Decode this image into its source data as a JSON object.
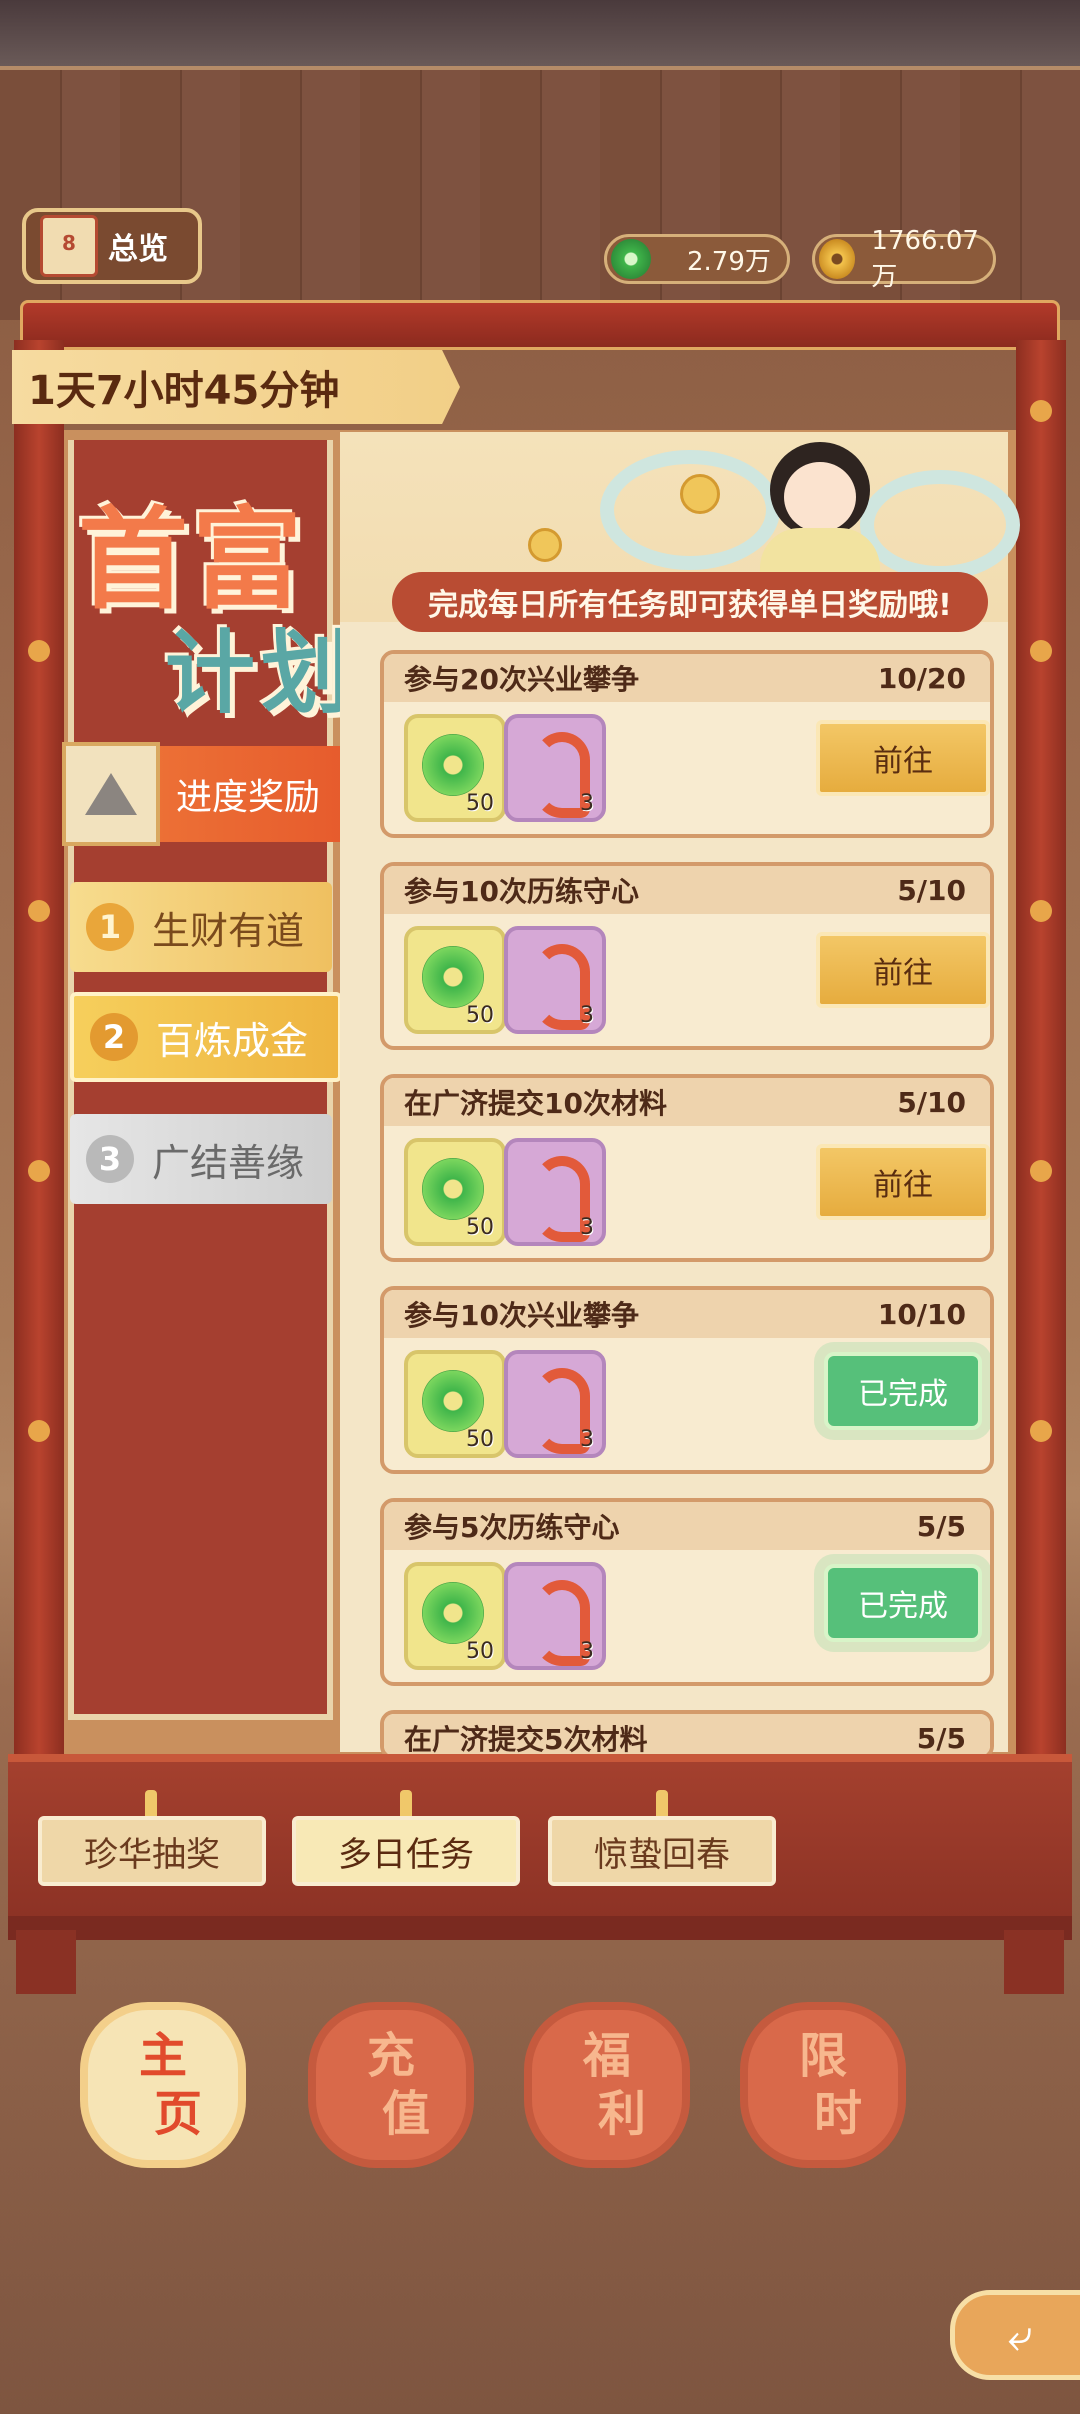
{
  "header": {
    "overview_label": "总览",
    "overview_icon_text": "8",
    "jade_amount": "2.79万",
    "gold_amount": "1766.07万"
  },
  "timer": "1天7小时45分钟",
  "event": {
    "title_line1": "首富",
    "title_line2": "计划",
    "progress_tab": "进度奖励",
    "tabs": [
      {
        "num": "1",
        "label": "生财有道",
        "state": "normal"
      },
      {
        "num": "2",
        "label": "百炼成金",
        "state": "selected"
      },
      {
        "num": "3",
        "label": "广结善缘",
        "state": "locked"
      }
    ],
    "notice": "完成每日所有任务即可获得单日奖励哦!"
  },
  "tasks": [
    {
      "name": "参与20次兴业攀争",
      "progress": "10/20",
      "jade_count": "50",
      "snake_count": "3",
      "action": "前往",
      "done": false
    },
    {
      "name": "参与10次历练守心",
      "progress": "5/10",
      "jade_count": "50",
      "snake_count": "3",
      "action": "前往",
      "done": false
    },
    {
      "name": "在广济提交10次材料",
      "progress": "5/10",
      "jade_count": "50",
      "snake_count": "3",
      "action": "前往",
      "done": false
    },
    {
      "name": "参与10次兴业攀争",
      "progress": "10/10",
      "jade_count": "50",
      "snake_count": "3",
      "action": "已完成",
      "done": true
    },
    {
      "name": "参与5次历练守心",
      "progress": "5/5",
      "jade_count": "50",
      "snake_count": "3",
      "action": "已完成",
      "done": true
    },
    {
      "name": "在广济提交5次材料",
      "progress": "5/5"
    }
  ],
  "bottom_tabs": [
    "珍华抽奖",
    "多日任务",
    "惊蛰回春"
  ],
  "active_bottom_tab": "多日任务",
  "main_nav": [
    {
      "line1": "主",
      "line2": "页",
      "active": true
    },
    {
      "line1": "充",
      "line2": "值",
      "active": false
    },
    {
      "line1": "福",
      "line2": "利",
      "active": false
    },
    {
      "line1": "限",
      "line2": "时",
      "active": false
    }
  ],
  "colors": {
    "accent_red": "#a53f30",
    "button_gold": "#e6ac3e",
    "done_green": "#56c07a",
    "jade_green": "#3fb54a"
  },
  "icons": {
    "overview": "calendar-icon",
    "jade": "jade-coin-icon",
    "gold": "gold-coin-icon",
    "back": "back-arrow-icon"
  }
}
